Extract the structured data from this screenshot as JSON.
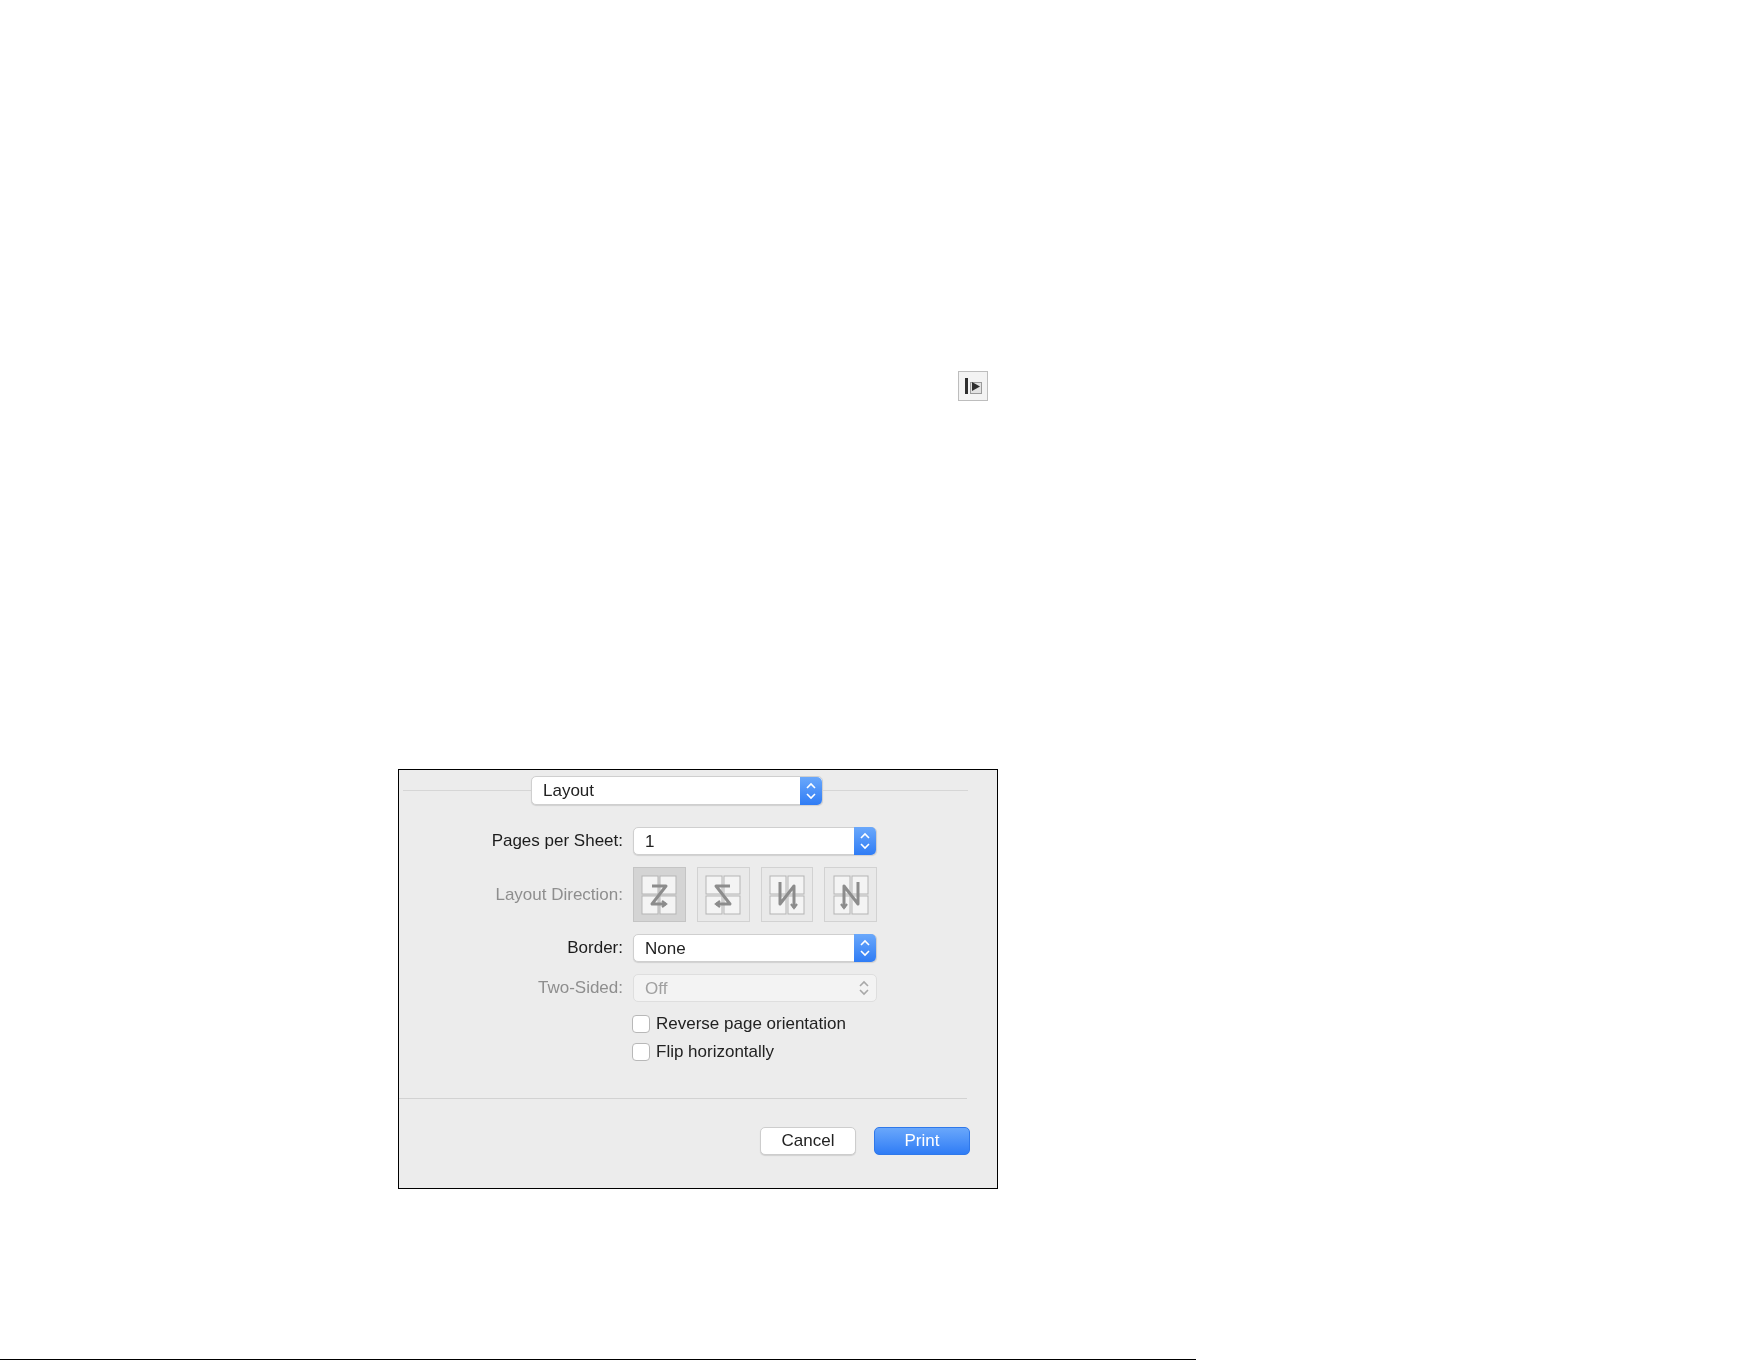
{
  "panel_dropdown": {
    "value": "Layout"
  },
  "settings": [
    {
      "kind": "dropdown",
      "label": "Pages per Sheet:",
      "value": "1",
      "disabled": false
    },
    {
      "kind": "direction",
      "label": "Layout Direction:",
      "disabled": true,
      "options": [
        {
          "selected": true
        },
        {
          "selected": false
        },
        {
          "selected": false
        },
        {
          "selected": false
        }
      ]
    },
    {
      "kind": "dropdown",
      "label": "Border:",
      "value": "None",
      "disabled": false
    },
    {
      "kind": "dropdown",
      "label": "Two-Sided:",
      "value": "Off",
      "disabled": true
    }
  ],
  "checkboxes": [
    {
      "label": "Reverse page orientation",
      "checked": false
    },
    {
      "label": "Flip horizontally",
      "checked": false
    }
  ],
  "buttons": [
    {
      "label": "Cancel",
      "kind": "cancel"
    },
    {
      "label": "Print",
      "kind": "default"
    }
  ]
}
